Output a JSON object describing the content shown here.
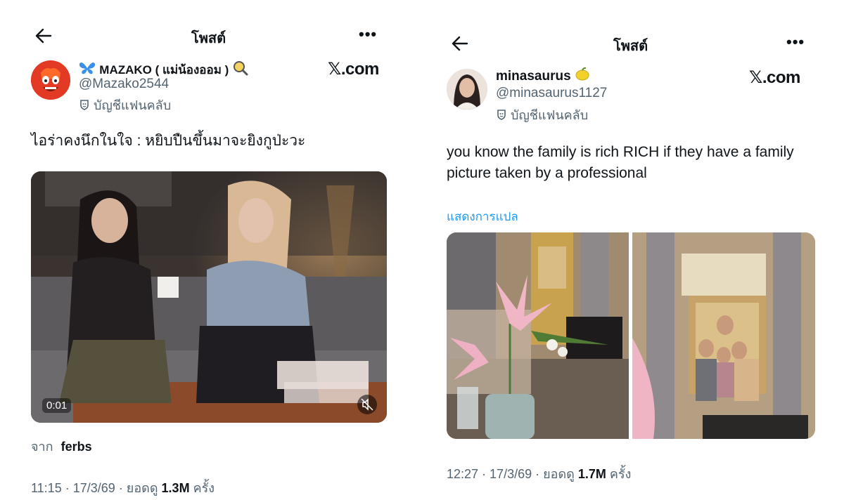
{
  "left_post": {
    "header": {
      "back_icon": "arrow-left-icon",
      "title": "โพสต์",
      "more": "•••"
    },
    "author": {
      "name_prefix_icon": "butterfly-icon",
      "name": "MAZAKO ( แม่น้องออม )",
      "name_suffix_icon": "magnifier-icon",
      "handle": "@Mazako2544",
      "badge_icon": "fanclub-badge-icon",
      "fanclub": "บัญชีแฟนคลับ"
    },
    "brand": "𝕏.com",
    "text": "ไอร่าคงนึกในใจ : หยิบปืนขึ้นมาจะยิงกูป่ะวะ",
    "video": {
      "time": "0:01",
      "mute_icon": "muted-speaker-icon"
    },
    "source": {
      "label": "จาก",
      "name": "ferbs"
    },
    "meta": {
      "time": "11:15",
      "sep1": " · ",
      "date": "17/3/69",
      "sep2": " · ",
      "views_label": "ยอดดู",
      "views": "1.3M",
      "views_unit": "ครั้ง"
    }
  },
  "right_post": {
    "header": {
      "back_icon": "arrow-left-icon",
      "title": "โพสต์",
      "more": "•••"
    },
    "author": {
      "name": "minasaurus",
      "name_suffix_icon": "lemon-icon",
      "handle": "@minasaurus1127",
      "badge_icon": "fanclub-badge-icon",
      "fanclub": "บัญชีแฟนคลับ"
    },
    "brand": "𝕏.com",
    "text": "you know the family is rich RICH if they have a family picture taken by a professional",
    "translate": "แสดงการแปล",
    "meta": {
      "time": "12:27",
      "sep1": " · ",
      "date": "17/3/69",
      "sep2": " · ",
      "views_label": "ยอดดู",
      "views": "1.7M",
      "views_unit": "ครั้ง"
    }
  },
  "colors": {
    "text": "#0f1419",
    "muted": "#536471",
    "link": "#1d9bf0",
    "background": "#ffffff"
  }
}
